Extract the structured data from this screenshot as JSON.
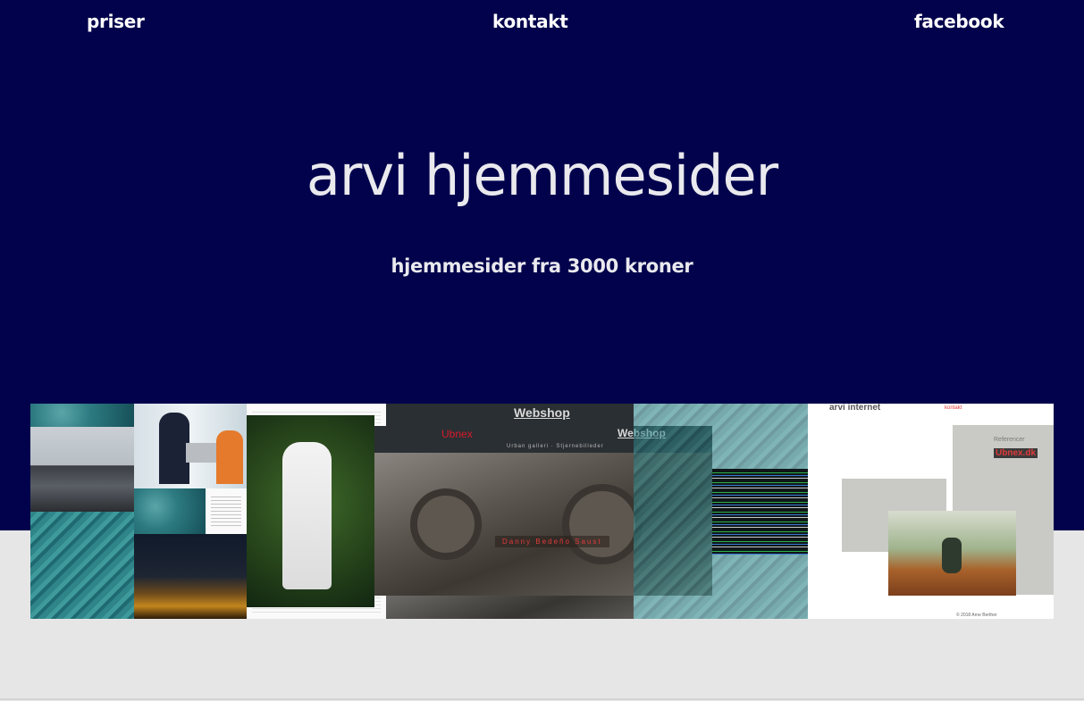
{
  "nav": {
    "priser": "priser",
    "kontakt": "kontakt",
    "facebook": "facebook"
  },
  "hero": {
    "title": "arvi hjemmesider",
    "subtitle": "hjemmesider fra 3000 kroner"
  },
  "collage": {
    "webshop_top": "Webshop",
    "webshop_inner": "Webshop",
    "ubnex": "Ubnex",
    "urban_line": "Urban galleri · Stjernebilleder",
    "danny": "Danny Bedeño Saust",
    "arvi_internet": "arvi internet",
    "kontakt_small": "kontakt",
    "referencer": "Referencer",
    "ubnex_dk": "Ubnex.dk",
    "copyright": "© 2018 Arne Berther"
  },
  "colors": {
    "hero_bg": "#02024c",
    "page_bg": "#e6e6e6",
    "text": "#e9e9ee"
  }
}
